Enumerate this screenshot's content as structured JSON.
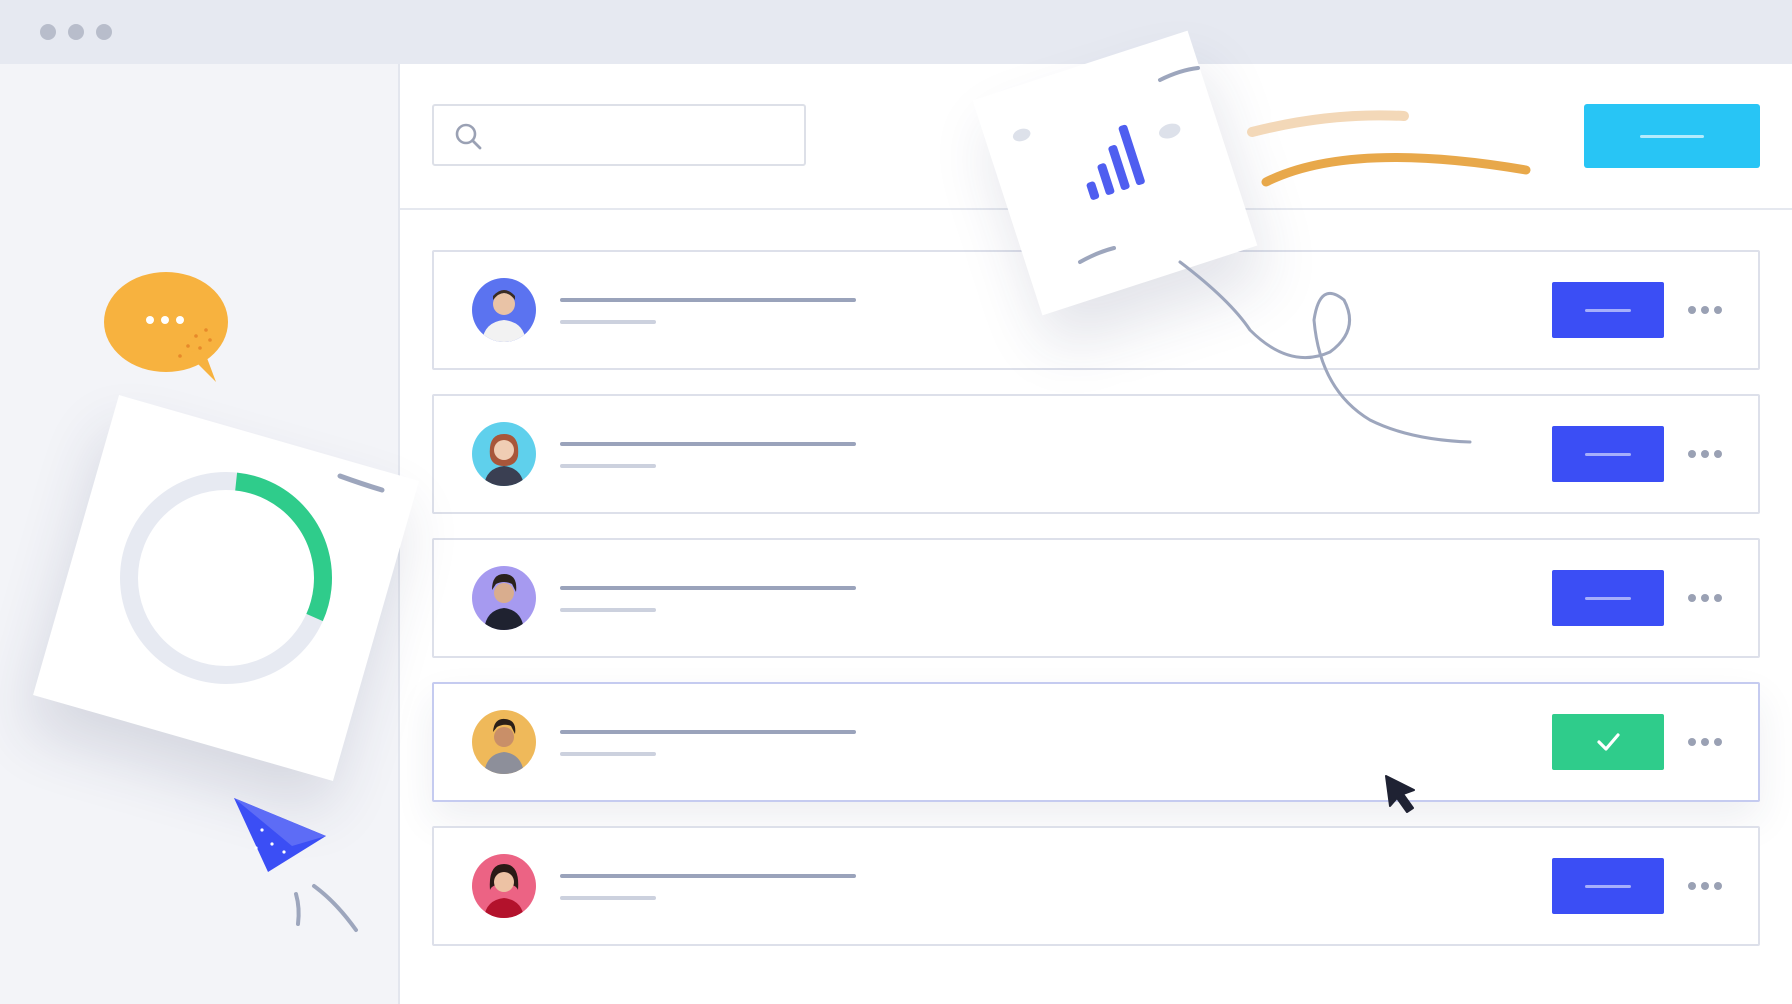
{
  "window": {
    "controls": [
      "window-dot",
      "window-dot",
      "window-dot"
    ]
  },
  "search": {
    "value": "",
    "placeholder": "",
    "icon": "search-icon"
  },
  "header": {
    "primary_button_label": "",
    "accent_color": "#28c5f5"
  },
  "rows": [
    {
      "title": "",
      "subtitle": "",
      "button_label": "",
      "button_state": "default",
      "button_color": "#3b4ef5",
      "avatar_bg": "#5b73f0"
    },
    {
      "title": "",
      "subtitle": "",
      "button_label": "",
      "button_state": "default",
      "button_color": "#3b4ef5",
      "avatar_bg": "#5fd0ec"
    },
    {
      "title": "",
      "subtitle": "",
      "button_label": "",
      "button_state": "default",
      "button_color": "#3b4ef5",
      "avatar_bg": "#a69af0"
    },
    {
      "title": "",
      "subtitle": "",
      "button_label": "",
      "button_state": "done",
      "button_color": "#2fcc8b",
      "avatar_bg": "#efb95a"
    },
    {
      "title": "",
      "subtitle": "",
      "button_label": "",
      "button_state": "default",
      "button_color": "#3b4ef5",
      "avatar_bg": "#ec6384"
    }
  ],
  "decorations": {
    "progress_ring_fraction": 0.3,
    "progress_color": "#2fcc8b",
    "chat_bubble_color": "#f7b23f",
    "chart_icon": "bar-chart-icon",
    "send_icon": "paper-plane-icon",
    "cursor_icon": "mouse-pointer-icon"
  }
}
